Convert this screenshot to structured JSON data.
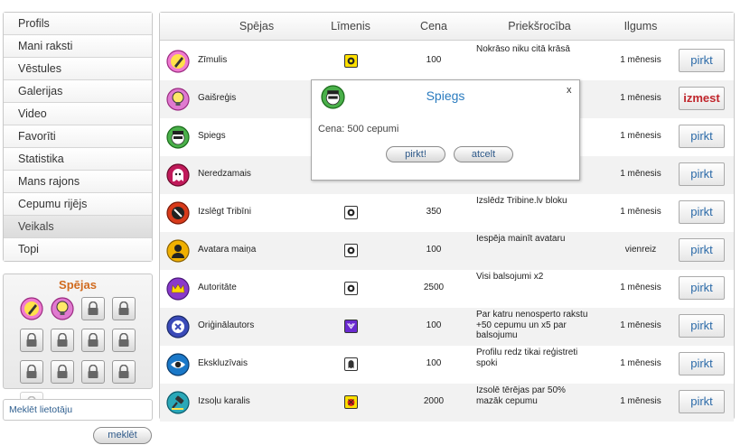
{
  "nav": {
    "items": [
      "Profils",
      "Mani raksti",
      "Vēstules",
      "Galerijas",
      "Video",
      "Favorīti",
      "Statistika",
      "Mans rajons",
      "Cepumu rijējs",
      "Veikals",
      "Topi"
    ],
    "active": "Veikals"
  },
  "abilities_panel": {
    "title": "Spējas"
  },
  "search": {
    "label": "Meklēt lietotāju",
    "button": "meklēt"
  },
  "table": {
    "headers": {
      "ability": "Spējas",
      "level": "Līmenis",
      "price": "Cena",
      "advantage": "Priekšrocība",
      "duration": "Ilgums"
    },
    "rows": [
      {
        "name": "Zīmulis",
        "price": "100",
        "advantage": "Nokrāso niku citā krāsā",
        "duration": "1 mēnesis",
        "action": "pirkt",
        "icon": "pencil-icon",
        "icon_color": "#f07ad0"
      },
      {
        "name": "Gaišreģis",
        "price": "",
        "advantage": "",
        "duration": "1 mēnesis",
        "action": "izmest",
        "icon": "lightbulb-icon",
        "icon_color": "#e07ad0"
      },
      {
        "name": "Spiegs",
        "price": "",
        "advantage": "",
        "duration": "1 mēnesis",
        "action": "pirkt",
        "icon": "spy-icon",
        "icon_color": "#4ab04a"
      },
      {
        "name": "Neredzamais",
        "price": "",
        "advantage": "",
        "duration": "1 mēnesis",
        "action": "pirkt",
        "icon": "ghost-icon",
        "icon_color": "#c01a5a"
      },
      {
        "name": "Izslēgt Tribīni",
        "price": "350",
        "advantage": "Izslēdz Tribine.lv bloku",
        "duration": "1 mēnesis",
        "action": "pirkt",
        "icon": "mute-icon",
        "icon_color": "#d83a1a"
      },
      {
        "name": "Avatara maiņa",
        "price": "100",
        "advantage": "Iespēja mainīt avataru",
        "duration": "vienreiz",
        "action": "pirkt",
        "icon": "avatar-icon",
        "icon_color": "#f0b000"
      },
      {
        "name": "Autoritāte",
        "price": "2500",
        "advantage": "Visi balsojumi x2",
        "duration": "1 mēnesis",
        "action": "pirkt",
        "icon": "crown-icon",
        "icon_color": "#8a3acb"
      },
      {
        "name": "Oriģinālautors",
        "price": "100",
        "advantage": "Par katru nenosperto rakstu +50 cepumu un x5 par balsojumu",
        "duration": "1 mēnesis",
        "action": "pirkt",
        "icon": "author-icon",
        "icon_color": "#3a4ab8"
      },
      {
        "name": "Ekskluzīvais",
        "price": "100",
        "advantage": "Profilu redz tikai reģistreti spoki",
        "duration": "1 mēnesis",
        "action": "pirkt",
        "icon": "eye-icon",
        "icon_color": "#1a78c8"
      },
      {
        "name": "Izsoļu karalis",
        "price": "2000",
        "advantage": "Izsolē tērējas par 50% mazāk cepumu",
        "duration": "1 mēnesis",
        "action": "pirkt",
        "icon": "gavel-icon",
        "icon_color": "#2aa8b8"
      }
    ]
  },
  "modal": {
    "title": "Spiegs",
    "close": "x",
    "cost": "Cena: 500 cepumi",
    "buy": "pirkt!",
    "cancel": "atcelt"
  }
}
